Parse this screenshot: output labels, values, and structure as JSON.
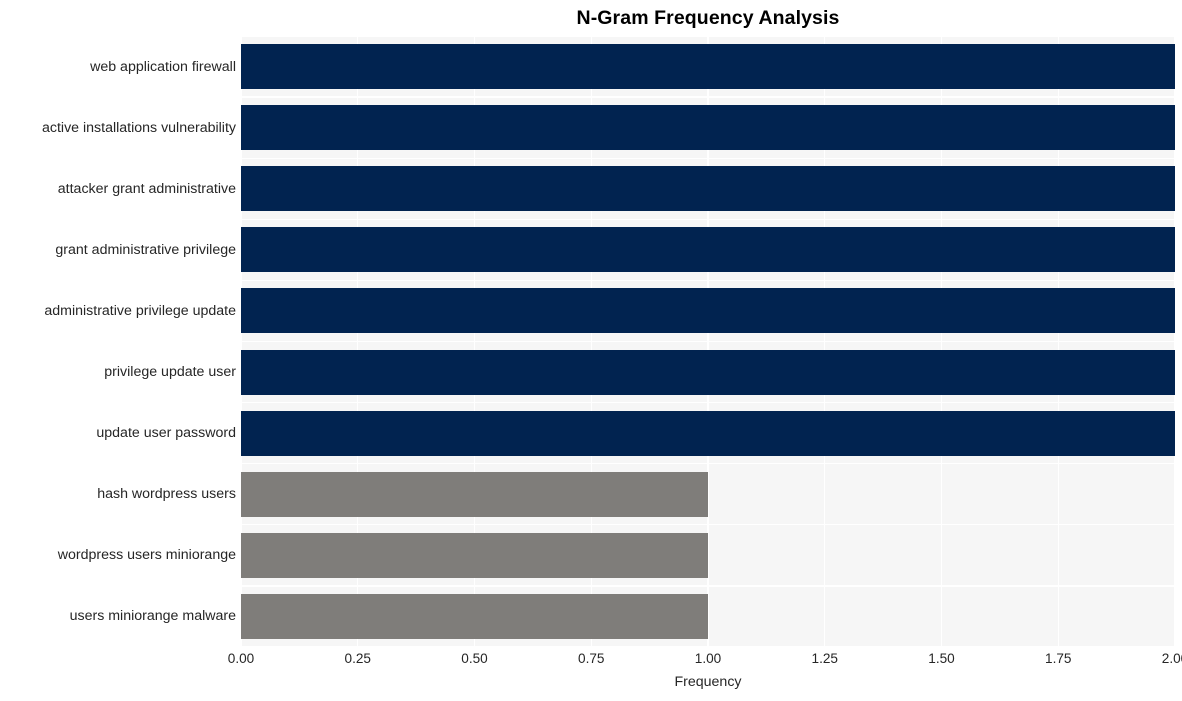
{
  "chart_data": {
    "type": "bar",
    "orientation": "horizontal",
    "title": "N-Gram Frequency Analysis",
    "xlabel": "Frequency",
    "ylabel": "",
    "xlim": [
      0.0,
      2.0
    ],
    "xticks": [
      "0.00",
      "0.25",
      "0.50",
      "0.75",
      "1.00",
      "1.25",
      "1.50",
      "1.75",
      "2.00"
    ],
    "xtick_values": [
      0.0,
      0.25,
      0.5,
      0.75,
      1.0,
      1.25,
      1.5,
      1.75,
      2.0
    ],
    "grid": true,
    "grid_color": "#ffffff",
    "plot_background": "#f6f6f6",
    "legend": null,
    "categories": [
      "web application firewall",
      "active installations vulnerability",
      "attacker grant administrative",
      "grant administrative privilege",
      "administrative privilege update",
      "privilege update user",
      "update user password",
      "hash wordpress users",
      "wordpress users miniorange",
      "users miniorange malware"
    ],
    "values": [
      2,
      2,
      2,
      2,
      2,
      2,
      2,
      1,
      1,
      1
    ],
    "bar_colors": [
      "#012350",
      "#012350",
      "#012350",
      "#012350",
      "#012350",
      "#012350",
      "#012350",
      "#7f7d7a",
      "#7f7d7a",
      "#7f7d7a"
    ],
    "colors": {
      "primary": "#012350",
      "secondary": "#7f7d7a",
      "text": "#262626",
      "title": "#000000"
    }
  }
}
